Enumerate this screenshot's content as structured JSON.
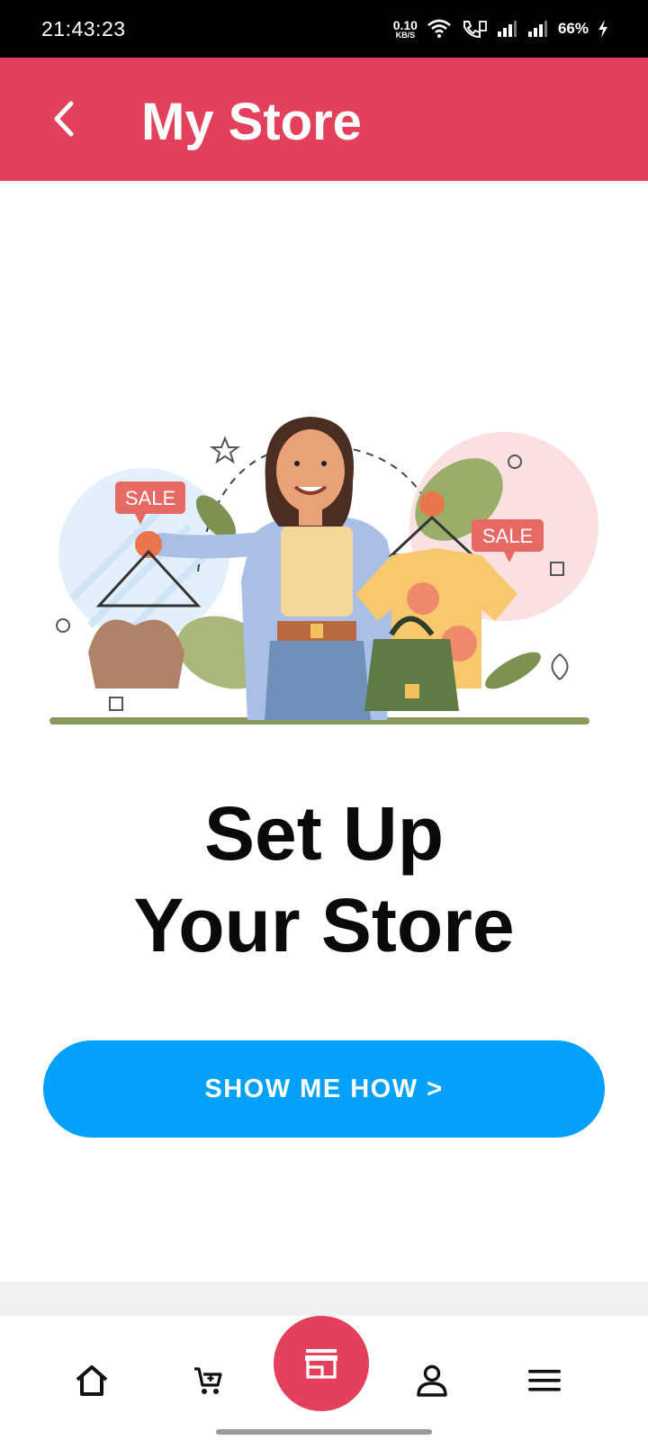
{
  "status_bar": {
    "time": "21:43:23",
    "net_speed_value": "0.10",
    "net_speed_unit": "KB/S",
    "battery": "66%"
  },
  "app_bar": {
    "title": "My Store",
    "back_icon": "chevron-left-icon"
  },
  "illustration": {
    "sale_tag_left": "SALE",
    "sale_tag_right": "SALE"
  },
  "main": {
    "headline_line1": "Set Up",
    "headline_line2": "Your Store",
    "cta_label": "SHOW ME HOW >"
  },
  "bottom_nav": {
    "items": [
      {
        "icon": "home-icon"
      },
      {
        "icon": "cart-icon"
      },
      {
        "icon": "store-icon",
        "active": true
      },
      {
        "icon": "profile-icon"
      },
      {
        "icon": "menu-icon"
      }
    ]
  },
  "colors": {
    "brand": "#e2405b",
    "cta": "#03a1fc"
  }
}
